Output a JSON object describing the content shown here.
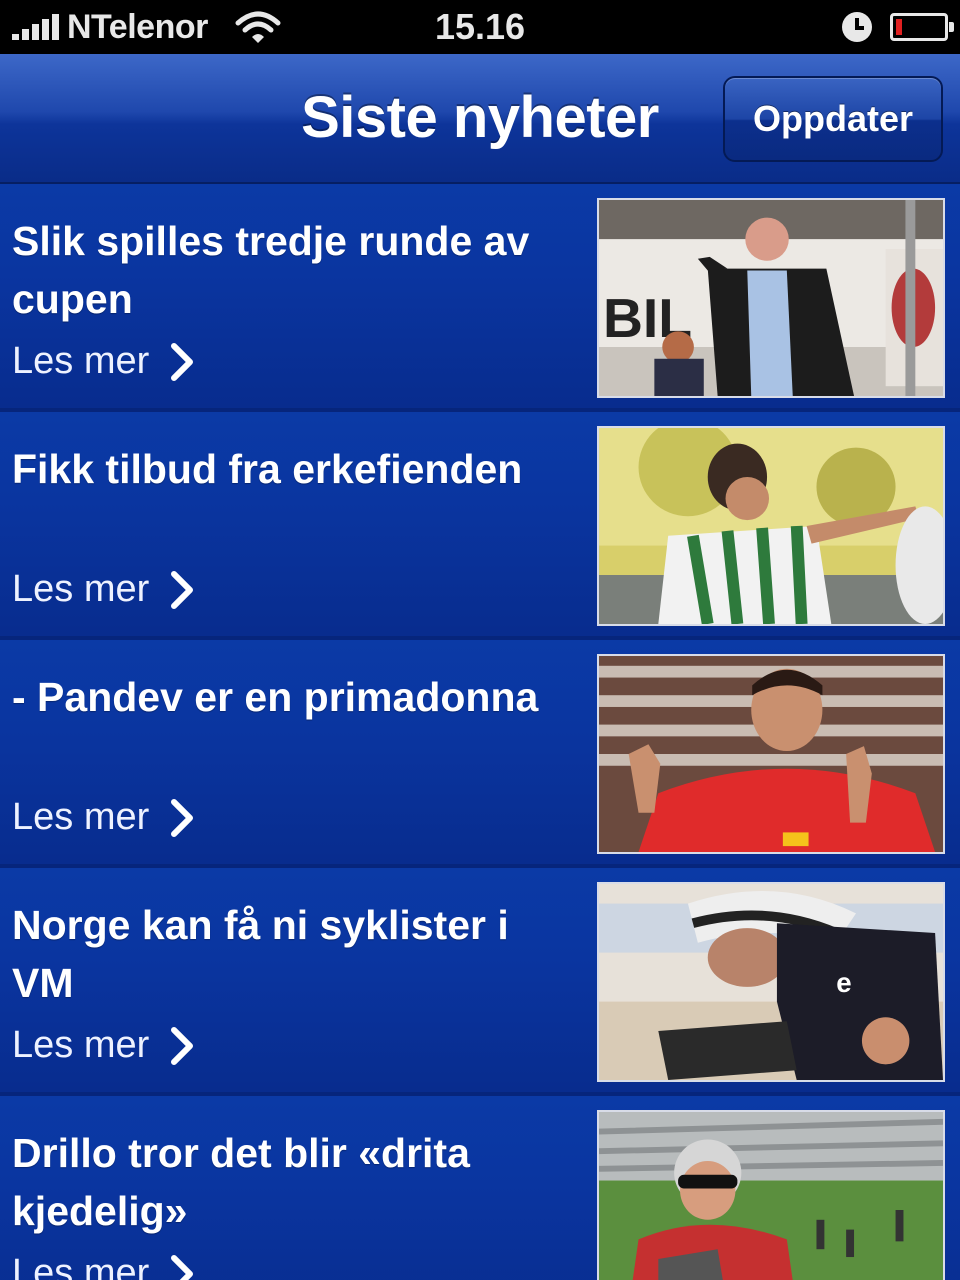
{
  "status_bar": {
    "carrier": "NTelenor",
    "time": "15.16",
    "icons": [
      "signal-icon",
      "wifi-icon",
      "alarm-clock-icon",
      "battery-icon"
    ]
  },
  "nav": {
    "title": "Siste nyheter",
    "refresh_label": "Oppdater"
  },
  "articles": [
    {
      "headline": "Slik spilles tredje runde av cupen",
      "read_more": "Les mer"
    },
    {
      "headline": "Fikk tilbud fra erkefienden",
      "read_more": "Les mer"
    },
    {
      "headline": "- Pandev er en primadonna",
      "read_more": "Les mer"
    },
    {
      "headline": "Norge kan få ni syklister i VM",
      "read_more": "Les mer"
    },
    {
      "headline": "Drillo tror det blir «drita kjedelig»",
      "read_more": "Les mer"
    }
  ],
  "colors": {
    "background": "#0a2f8c",
    "nav_top": "#3d68c8",
    "nav_bottom": "#0a2c88",
    "status_bar": "#000000"
  }
}
